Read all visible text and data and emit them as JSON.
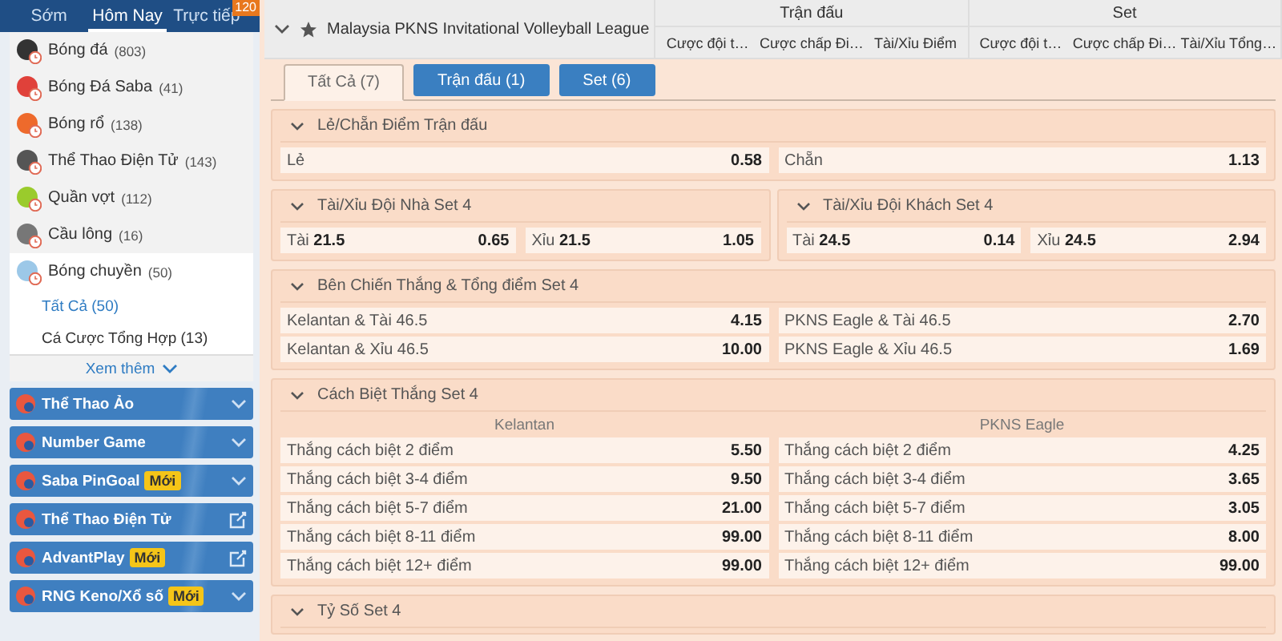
{
  "sidebar": {
    "tabs": [
      {
        "label": "Sớm",
        "selected": false
      },
      {
        "label": "Hôm Nay",
        "selected": true
      },
      {
        "label": "Trực tiếp",
        "selected": false,
        "badge": "120"
      }
    ],
    "sports": [
      {
        "name": "Bóng đá",
        "count": "(803)",
        "color": "#333333",
        "selected": false
      },
      {
        "name": "Bóng Đá Saba",
        "count": "(41)",
        "color": "#e0413a",
        "selected": false
      },
      {
        "name": "Bóng rổ",
        "count": "(138)",
        "color": "#ee6a2c",
        "selected": false
      },
      {
        "name": "Thể Thao Điện Tử",
        "count": "(143)",
        "color": "#555555",
        "selected": false
      },
      {
        "name": "Quần vợt",
        "count": "(112)",
        "color": "#9acb2c",
        "selected": false
      },
      {
        "name": "Cầu lông",
        "count": "(16)",
        "color": "#777777",
        "selected": false
      },
      {
        "name": "Bóng chuyền",
        "count": "(50)",
        "color": "#9cc8e8",
        "selected": true
      }
    ],
    "subitems": [
      {
        "label": "Tất Cả (50)",
        "selected": true
      },
      {
        "label": "Cá Cược Tổng Hợp (13)",
        "selected": false
      }
    ],
    "more": "Xem thêm",
    "promos": [
      {
        "name": "Thể Thao Ảo",
        "kind": "expand"
      },
      {
        "name": "Number Game",
        "kind": "expand"
      },
      {
        "name": "Saba PinGoal",
        "badge": "Mới",
        "kind": "expand"
      },
      {
        "name": "Thể Thao Điện Tử",
        "kind": "external"
      },
      {
        "name": "AdvantPlay",
        "badge": "Mới",
        "kind": "external"
      },
      {
        "name": "RNG Keno/Xổ số",
        "badge": "Mới",
        "kind": "expand"
      }
    ]
  },
  "league": {
    "name": "Malaysia PKNS Invitational Volleyball League",
    "groups": [
      {
        "title": "Trận đấu",
        "columns": [
          "Cược đội t…",
          "Cược chấp Đi…",
          "Tài/Xỉu Điểm"
        ]
      },
      {
        "title": "Set",
        "columns": [
          "Cược đội t…",
          "Cược chấp Đi…",
          "Tài/Xỉu Tổng…"
        ]
      }
    ]
  },
  "filters": [
    {
      "label": "Tất Cả (7)",
      "selected": true
    },
    {
      "label": "Trận đấu (1)",
      "selected": false
    },
    {
      "label": "Set (6)",
      "selected": false
    }
  ],
  "markets": [
    {
      "kind": "full",
      "title": "Lẻ/Chẵn Điểm Trận đấu",
      "rows": [
        [
          {
            "label": "Lẻ",
            "odds": "0.58"
          },
          {
            "label": "Chẵn",
            "odds": "1.13"
          }
        ]
      ]
    },
    {
      "kind": "half",
      "title": "Tài/Xỉu Đội Nhà Set 4",
      "rows": [
        [
          {
            "label": "Tài **21.5**",
            "odds": "0.65"
          },
          {
            "label": "Xỉu **21.5**",
            "odds": "1.05"
          }
        ]
      ]
    },
    {
      "kind": "half",
      "title": "Tài/Xỉu Đội Khách Set 4",
      "rows": [
        [
          {
            "label": "Tài **24.5**",
            "odds": "0.14"
          },
          {
            "label": "Xỉu **24.5**",
            "odds": "2.94"
          }
        ]
      ]
    },
    {
      "kind": "full",
      "title": "Bên Chiến Thắng & Tổng điểm Set 4",
      "rows": [
        [
          {
            "label": "Kelantan & Tài 46.5",
            "odds": "4.15"
          },
          {
            "label": "PKNS Eagle & Tài 46.5",
            "odds": "2.70"
          }
        ],
        [
          {
            "label": "Kelantan & Xỉu 46.5",
            "odds": "10.00"
          },
          {
            "label": "PKNS Eagle & Xỉu 46.5",
            "odds": "1.69"
          }
        ]
      ]
    },
    {
      "kind": "full",
      "title": "Cách Biệt Thắng Set 4",
      "columns": [
        "Kelantan",
        "PKNS Eagle"
      ],
      "rows": [
        [
          {
            "label": "Thắng cách biệt 2 điểm",
            "odds": "5.50"
          },
          {
            "label": "Thắng cách biệt 2 điểm",
            "odds": "4.25"
          }
        ],
        [
          {
            "label": "Thắng cách biệt 3-4 điểm",
            "odds": "9.50"
          },
          {
            "label": "Thắng cách biệt 3-4 điểm",
            "odds": "3.65"
          }
        ],
        [
          {
            "label": "Thắng cách biệt 5-7 điểm",
            "odds": "21.00"
          },
          {
            "label": "Thắng cách biệt 5-7 điểm",
            "odds": "3.05"
          }
        ],
        [
          {
            "label": "Thắng cách biệt 8-11 điểm",
            "odds": "99.00"
          },
          {
            "label": "Thắng cách biệt 8-11 điểm",
            "odds": "8.00"
          }
        ],
        [
          {
            "label": "Thắng cách biệt 12+ điểm",
            "odds": "99.00"
          },
          {
            "label": "Thắng cách biệt 12+ điểm",
            "odds": "99.00"
          }
        ]
      ]
    },
    {
      "kind": "full",
      "title": "Tỷ Số Set 4"
    }
  ]
}
